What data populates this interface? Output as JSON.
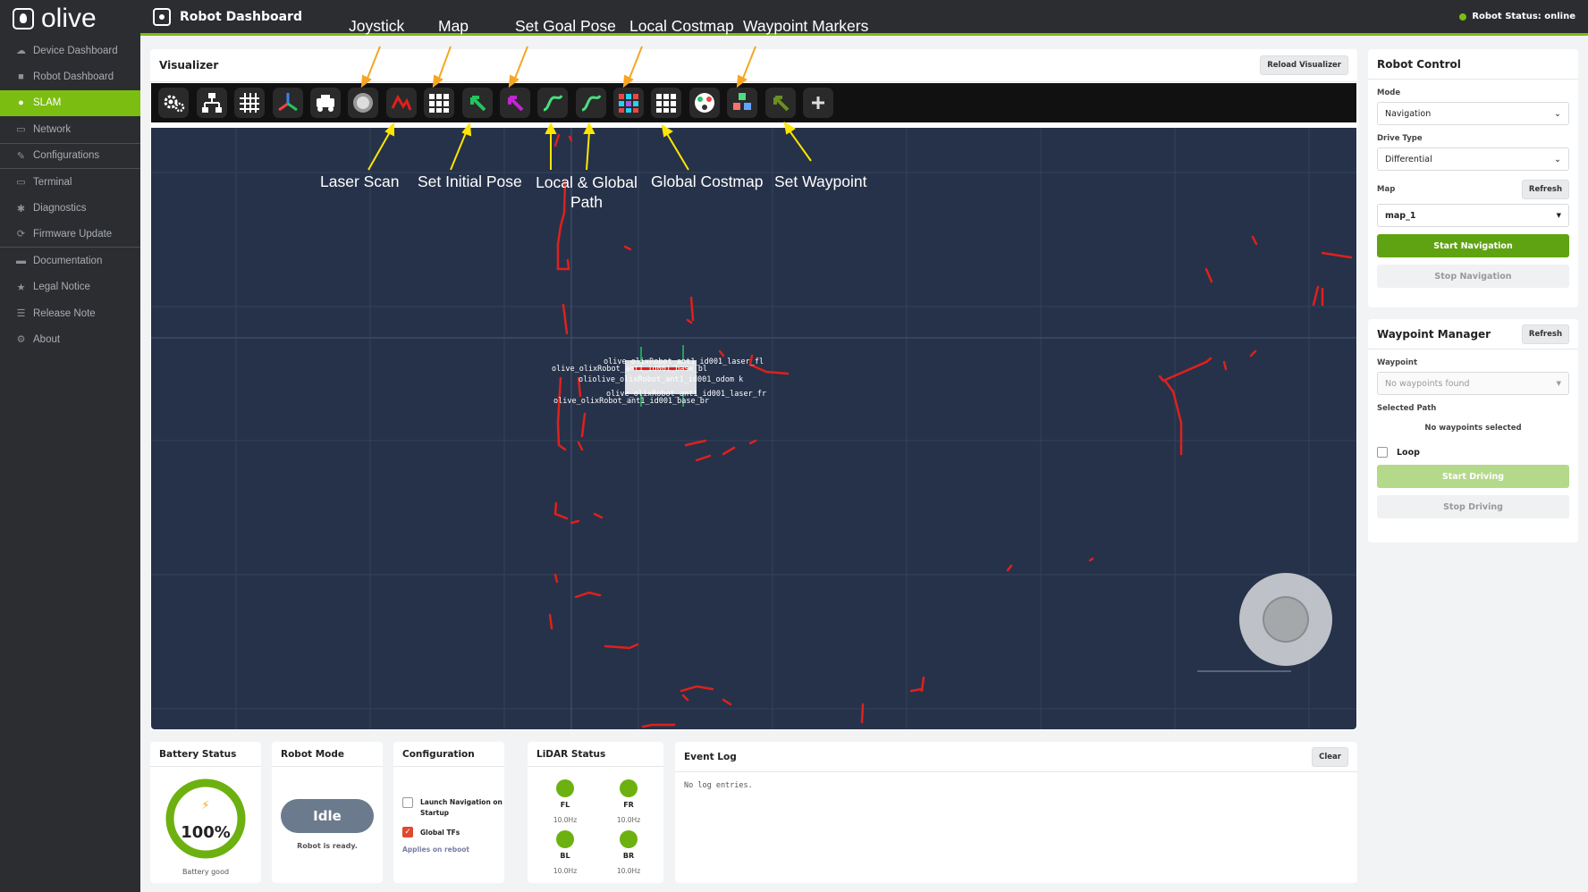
{
  "app": {
    "logo_text": "olive",
    "page_title": "Robot Dashboard",
    "robot_status": "Robot Status: online"
  },
  "sidebar": {
    "items": [
      {
        "label": "Device Dashboard",
        "icon": "cloud-icon"
      },
      {
        "label": "Robot Dashboard",
        "icon": "video-icon"
      },
      {
        "label": "SLAM",
        "icon": "map-pin-icon"
      },
      {
        "label": "Network",
        "icon": "monitor-icon"
      },
      {
        "label": "Configurations",
        "icon": "edit-icon"
      },
      {
        "label": "Terminal",
        "icon": "terminal-icon"
      },
      {
        "label": "Diagnostics",
        "icon": "bug-icon"
      },
      {
        "label": "Firmware Update",
        "icon": "refresh-icon"
      },
      {
        "label": "Documentation",
        "icon": "folder-icon"
      },
      {
        "label": "Legal Notice",
        "icon": "star-icon"
      },
      {
        "label": "Release Note",
        "icon": "list-icon"
      },
      {
        "label": "About",
        "icon": "gear-icon"
      }
    ]
  },
  "annotations": {
    "joystick": "Joystick",
    "map": "Map",
    "set_goal_pose": "Set Goal Pose",
    "local_costmap": "Local Costmap",
    "waypoint_markers": "Waypoint Markers",
    "laser_scan": "Laser Scan",
    "set_initial_pose": "Set Initial Pose",
    "local_global_path_line1": "Local & Global",
    "local_global_path_line2": "Path",
    "global_costmap": "Global Costmap",
    "set_waypoint": "Set Waypoint"
  },
  "visualizer": {
    "title": "Visualizer",
    "reload_label": "Reload Visualizer",
    "tools": [
      "settings-icon",
      "tf-tree-icon",
      "grid-icon",
      "axes-icon",
      "robot-model-icon",
      "joystick-icon",
      "laser-scan-icon",
      "map-icon",
      "set-initial-pose-icon",
      "set-goal-pose-icon",
      "local-path-icon",
      "global-path-icon",
      "local-costmap-icon",
      "global-costmap-icon",
      "markers-icon",
      "waypoint-markers-icon",
      "set-waypoint-icon",
      "add-icon"
    ],
    "frame_labels": {
      "l1": "olive_olixRobot_ant1_id001_laser_fl",
      "l2": "olive_olixRobot_ant1_id001_base_bl",
      "l3": "oliolive_olixRobot_ant1_id001_odom k",
      "l4": "olive_olixRobot_ant1_id001_laser_fr",
      "l5": "olive_olixRobot_ant1_id001_base_br"
    }
  },
  "robot_control": {
    "title": "Robot Control",
    "mode_label": "Mode",
    "mode_value": "Navigation",
    "drive_label": "Drive Type",
    "drive_value": "Differential",
    "map_label": "Map",
    "map_refresh": "Refresh",
    "map_value": "map_1",
    "start_nav": "Start Navigation",
    "stop_nav": "Stop Navigation"
  },
  "waypoint_manager": {
    "title": "Waypoint Manager",
    "refresh": "Refresh",
    "waypoint_label": "Waypoint",
    "waypoint_placeholder": "No waypoints found",
    "selected_path_label": "Selected Path",
    "selected_path_value": "No waypoints selected",
    "loop_label": "Loop",
    "start_driving": "Start Driving",
    "stop_driving": "Stop Driving"
  },
  "battery": {
    "title": "Battery Status",
    "percent": "100%",
    "level": 1.0,
    "status": "Battery good"
  },
  "robot_mode": {
    "title": "Robot Mode",
    "mode": "Idle",
    "status": "Robot is ready."
  },
  "configuration": {
    "title": "Configuration",
    "opt1_line1": "Launch Navigation on",
    "opt1_line2": "Startup",
    "opt1_checked": false,
    "opt2": "Global TFs",
    "opt2_checked": true,
    "note": "Applies on reboot"
  },
  "lidar": {
    "title": "LiDAR Status",
    "sensors": [
      {
        "name": "FL",
        "hz": "10.0Hz"
      },
      {
        "name": "FR",
        "hz": "10.0Hz"
      },
      {
        "name": "BL",
        "hz": "10.0Hz"
      },
      {
        "name": "BR",
        "hz": "10.0Hz"
      }
    ]
  },
  "event_log": {
    "title": "Event Log",
    "clear": "Clear",
    "empty": "No log entries."
  },
  "colors": {
    "accent": "#7cbd12",
    "dark_bg": "#2b2d30",
    "canvas": "#263249",
    "scan": "#e0201c"
  }
}
